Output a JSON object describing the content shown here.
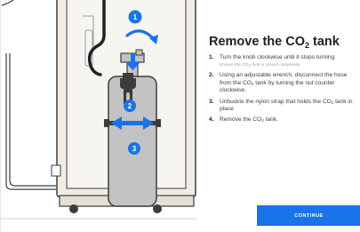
{
  "title": {
    "prefix": "Remove the CO",
    "sub": "2",
    "suffix": " tank"
  },
  "steps": [
    {
      "num": "1.",
      "text": "Turn the knob clockwise until it stops turning.",
      "note": {
        "prefix": "Ensure the CO",
        "sub": "2",
        "suffix": " tank is closed completely"
      }
    },
    {
      "num": "2.",
      "prefix": "Using an adjustable wrench, disconnect the hose from the CO",
      "sub": "2",
      "suffix": " tank by turning the nut counter clockwise."
    },
    {
      "num": "3.",
      "prefix": "Unbuckle the nylon strap that holds the CO",
      "sub": "2",
      "suffix": " tank in place"
    },
    {
      "num": "4.",
      "prefix": "Remove the CO",
      "sub": "2",
      "suffix": " tank."
    }
  ],
  "illustration": {
    "badges": [
      "1",
      "2",
      "3"
    ]
  },
  "continue_label": "CONTINUE",
  "colors": {
    "accent": "#1a73e8",
    "tank": "#c3c3c3",
    "cabinet": "#f1ede4",
    "outline": "#3c3c3c",
    "hose": "#202124"
  },
  "icons": [
    "turn-arrow-icon",
    "down-arrow-icon",
    "double-arrow-icon",
    "wrench-icon"
  ]
}
